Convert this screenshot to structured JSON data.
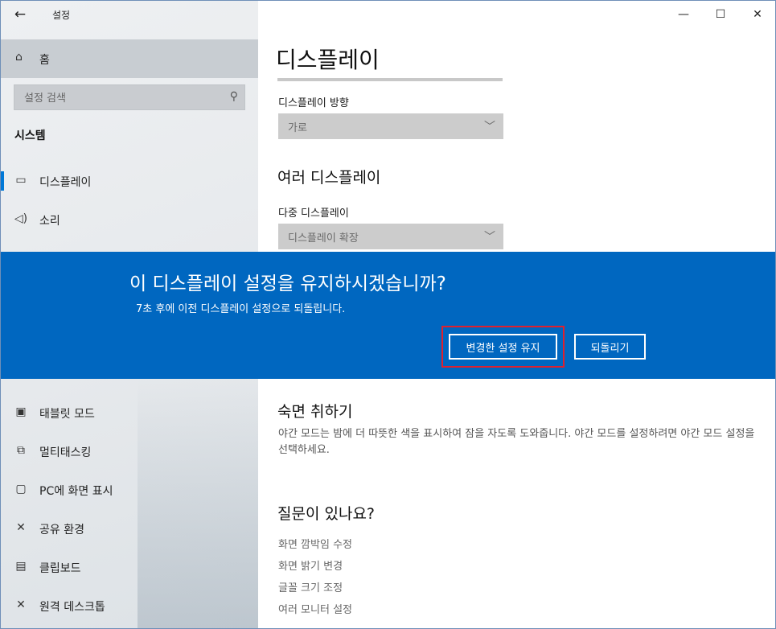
{
  "titlebar": {
    "title": "설정",
    "back_icon": "back-arrow-icon",
    "min": "—",
    "max": "☐",
    "close": "✕"
  },
  "sidebar": {
    "home_label": "홈",
    "search_placeholder": "설정 검색",
    "section_header": "시스템",
    "items_top": [
      {
        "label": "디스플레이",
        "icon": "monitor-icon"
      },
      {
        "label": "소리",
        "icon": "speaker-icon"
      }
    ],
    "items_bottom": [
      {
        "label": "태블릿 모드",
        "icon": "tablet-icon"
      },
      {
        "label": "멀티태스킹",
        "icon": "multitask-icon"
      },
      {
        "label": "PC에 화면 표시",
        "icon": "project-icon"
      },
      {
        "label": "공유 환경",
        "icon": "share-icon"
      },
      {
        "label": "클립보드",
        "icon": "clipboard-icon"
      },
      {
        "label": "원격 데스크톱",
        "icon": "remote-icon"
      }
    ]
  },
  "main": {
    "page_title": "디스플레이",
    "orientation_label": "디스플레이 방향",
    "orientation_value": "가로",
    "multi_heading": "여러 디스플레이",
    "multi_label": "다중 디스플레이",
    "multi_value": "디스플레이 확장",
    "sleep_heading": "숙면 취하기",
    "sleep_text": "야간 모드는 밤에 더 따뜻한 색을 표시하여 잠을 자도록 도와줍니다. 야간 모드를 설정하려면 야간 모드 설정을 선택하세요.",
    "faq_heading": "질문이 있나요?",
    "links": [
      "화면 깜박임 수정",
      "화면 밝기 변경",
      "글꼴 크기 조정",
      "여러 모니터 설정"
    ]
  },
  "dialog": {
    "title": "이 디스플레이 설정을 유지하시겠습니까?",
    "message": "7초 후에 이전 디스플레이 설정으로 되돌립니다.",
    "keep_label": "변경한 설정 유지",
    "revert_label": "되돌리기"
  },
  "colors": {
    "accent": "#0078d7",
    "dialog_bg": "#0067c0",
    "highlight": "#e1202d"
  }
}
